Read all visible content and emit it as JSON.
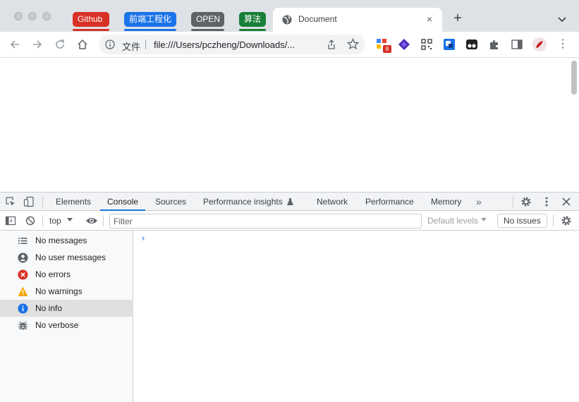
{
  "tab_groups": [
    {
      "label": "Github",
      "color": "#d93025"
    },
    {
      "label": "前端工程化",
      "color": "#1a73e8"
    },
    {
      "label": "OPEN",
      "color": "#5f6368"
    },
    {
      "label": "算法",
      "color": "#188038"
    }
  ],
  "active_tab": {
    "title": "Document",
    "close": "×"
  },
  "new_tab": "+",
  "omnibox": {
    "scheme_label": "文件",
    "url": "file:///Users/pczheng/Downloads/..."
  },
  "extensions": {
    "badge": "8"
  },
  "devtools": {
    "tabs": [
      "Elements",
      "Console",
      "Sources",
      "Performance insights",
      "Network",
      "Performance",
      "Memory"
    ],
    "more": "»",
    "context": "top",
    "filter_placeholder": "Filter",
    "levels": "Default levels",
    "issues": "No issues",
    "sidebar": [
      {
        "label": "No messages",
        "icon": "list-icon"
      },
      {
        "label": "No user messages",
        "icon": "user-icon"
      },
      {
        "label": "No errors",
        "icon": "error-icon"
      },
      {
        "label": "No warnings",
        "icon": "warning-icon"
      },
      {
        "label": "No info",
        "icon": "info-icon"
      },
      {
        "label": "No verbose",
        "icon": "bug-icon"
      }
    ],
    "prompt": "›"
  }
}
